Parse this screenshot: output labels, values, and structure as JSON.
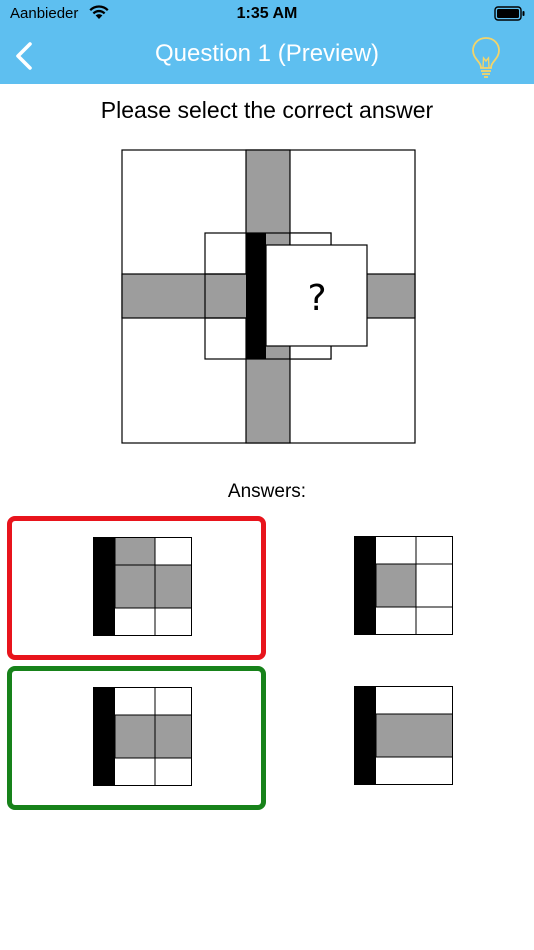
{
  "status_bar": {
    "carrier": "Aanbieder",
    "time": "1:35 AM"
  },
  "nav": {
    "title": "Question 1 (Preview)",
    "back_icon": "chevron-left-icon",
    "hint_icon": "lightbulb-icon"
  },
  "prompt": "Please select the correct answer",
  "puzzle": {
    "missing_label": "?"
  },
  "answers": {
    "label": "Answers:",
    "options": [
      {
        "id": 1,
        "state": "incorrect"
      },
      {
        "id": 2,
        "state": "none"
      },
      {
        "id": 3,
        "state": "correct"
      },
      {
        "id": 4,
        "state": "none"
      }
    ]
  },
  "colors": {
    "header": "#5ebff0",
    "incorrect_border": "#e8141c",
    "correct_border": "#17821a",
    "cell_gray": "#9d9d9d",
    "bar_black": "#000000",
    "hint_icon": "#f2d46b"
  }
}
